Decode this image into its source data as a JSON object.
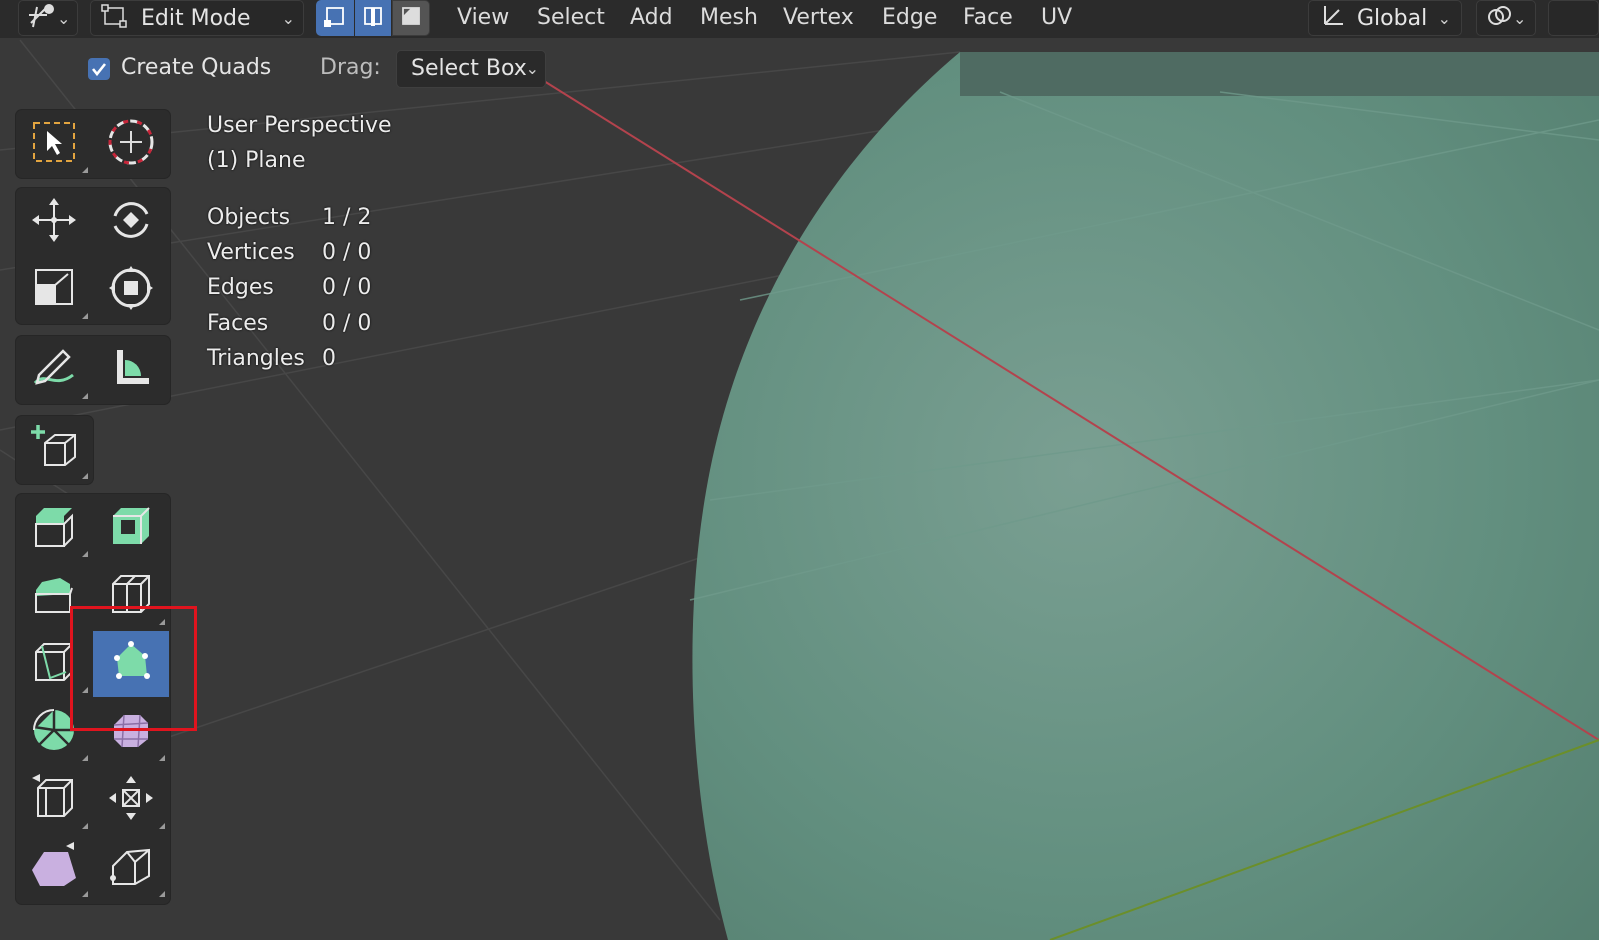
{
  "header": {
    "mode_label": "Edit Mode",
    "menus": [
      "View",
      "Select",
      "Add",
      "Mesh",
      "Vertex",
      "Edge",
      "Face",
      "UV"
    ],
    "transform_orientation": "Global",
    "icons": {
      "editor_type": "transform-cursor-icon",
      "mode": "edit-mode-icon",
      "select_vertex": "vertex-select-icon",
      "select_edge": "edge-select-icon",
      "select_face": "face-select-icon",
      "orientation": "orientation-axes-icon",
      "pivot": "snap-link-icon"
    }
  },
  "tool_settings": {
    "create_quads_label": "Create Quads",
    "create_quads_checked": true,
    "drag_label": "Drag:",
    "drag_value": "Select Box"
  },
  "overlay": {
    "perspective": "User Perspective",
    "object": "(1) Plane",
    "stats": [
      {
        "label": "Objects",
        "value": "1 / 2"
      },
      {
        "label": "Vertices",
        "value": "0 / 0"
      },
      {
        "label": "Edges",
        "value": "0 / 0"
      },
      {
        "label": "Faces",
        "value": "0 / 0"
      },
      {
        "label": "Triangles",
        "value": "0"
      }
    ]
  },
  "toolbar": {
    "tools": [
      "select-box-icon",
      "cursor-icon",
      "move-icon",
      "rotate-icon",
      "scale-icon",
      "transform-icon",
      "annotate-icon",
      "measure-icon",
      "add-cube-icon",
      "extrude-region-icon",
      "inset-faces-icon",
      "bevel-icon",
      "loop-cut-icon",
      "knife-icon",
      "poly-build-icon",
      "spin-icon",
      "smooth-icon",
      "edge-slide-icon",
      "shrink-fatten-icon",
      "shear-icon",
      "rip-region-icon"
    ],
    "active_tool": "poly-build-icon"
  },
  "colors": {
    "accent": "#4772b3",
    "mesh": "#5f8f7f",
    "x_axis": "#b3434d",
    "y_axis": "#6b8f2a",
    "highlight_box": "#e0141e"
  }
}
